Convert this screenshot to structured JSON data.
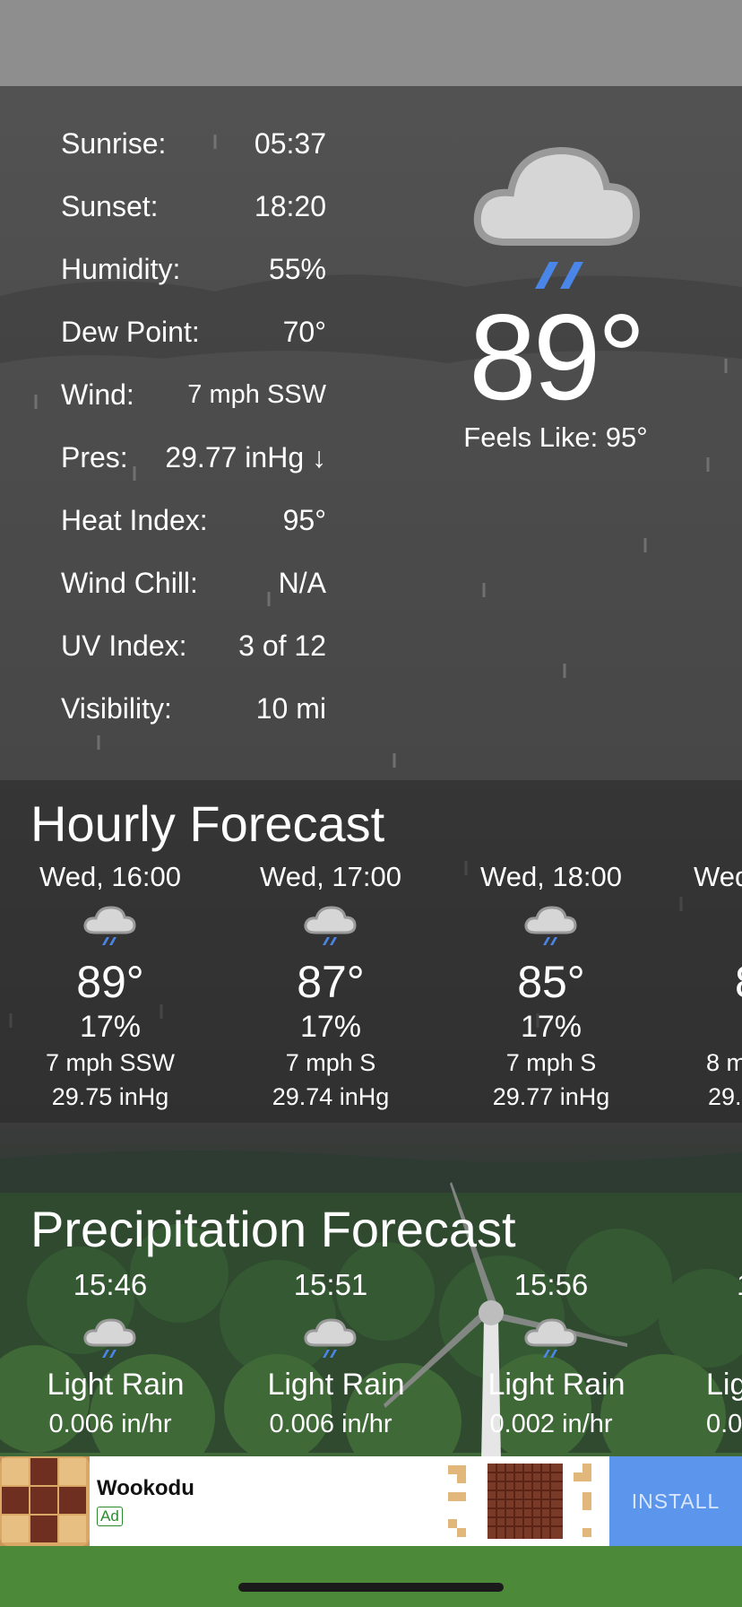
{
  "details": [
    {
      "label": "Sunrise:",
      "value": "05:37"
    },
    {
      "label": "Sunset:",
      "value": "18:20"
    },
    {
      "label": "Humidity:",
      "value": "55%"
    },
    {
      "label": "Dew Point:",
      "value": "70°"
    },
    {
      "label": "Wind:",
      "value": "7 mph SSW"
    },
    {
      "label": "Pres:",
      "value": "29.77 inHg ↓"
    },
    {
      "label": "Heat Index:",
      "value": "95°"
    },
    {
      "label": "Wind Chill:",
      "value": "N/A"
    },
    {
      "label": "UV Index:",
      "value": "3 of 12"
    },
    {
      "label": "Visibility:",
      "value": "10 mi"
    }
  ],
  "current": {
    "temperature": "89°",
    "feels_like": "Feels Like: 95°",
    "icon": "cloud-rain-icon"
  },
  "hourly": {
    "title": "Hourly Forecast",
    "items": [
      {
        "time": "Wed, 16:00",
        "icon": "cloud-rain-icon",
        "temp": "89°",
        "precip": "17%",
        "wind": "7 mph SSW",
        "pressure": "29.75 inHg"
      },
      {
        "time": "Wed, 17:00",
        "icon": "cloud-rain-icon",
        "temp": "87°",
        "precip": "17%",
        "wind": "7 mph S",
        "pressure": "29.74 inHg"
      },
      {
        "time": "Wed, 18:00",
        "icon": "cloud-rain-icon",
        "temp": "85°",
        "precip": "17%",
        "wind": "7 mph S",
        "pressure": "29.77 inHg"
      },
      {
        "time": "Wed",
        "icon": "cloud-rain-icon",
        "temp": "8",
        "precip": "",
        "wind": "8 m",
        "pressure": "29."
      }
    ]
  },
  "precipitation": {
    "title": "Precipitation Forecast",
    "items": [
      {
        "time": "15:46",
        "icon": "cloud-rain-icon",
        "condition": "Light Rain",
        "rate": "0.006 in/hr"
      },
      {
        "time": "15:51",
        "icon": "cloud-rain-icon",
        "condition": "Light Rain",
        "rate": "0.006 in/hr"
      },
      {
        "time": "15:56",
        "icon": "cloud-rain-icon",
        "condition": "Light Rain",
        "rate": "0.002 in/hr"
      },
      {
        "time": "1",
        "icon": "cloud-rain-icon",
        "condition": "Lig",
        "rate": "0.0"
      }
    ]
  },
  "ad": {
    "app_name": "Wookodu",
    "tag": "Ad",
    "install_label": "INSTALL"
  },
  "colors": {
    "rain_accent": "#4a86e8",
    "install_button": "#5b95ec"
  }
}
